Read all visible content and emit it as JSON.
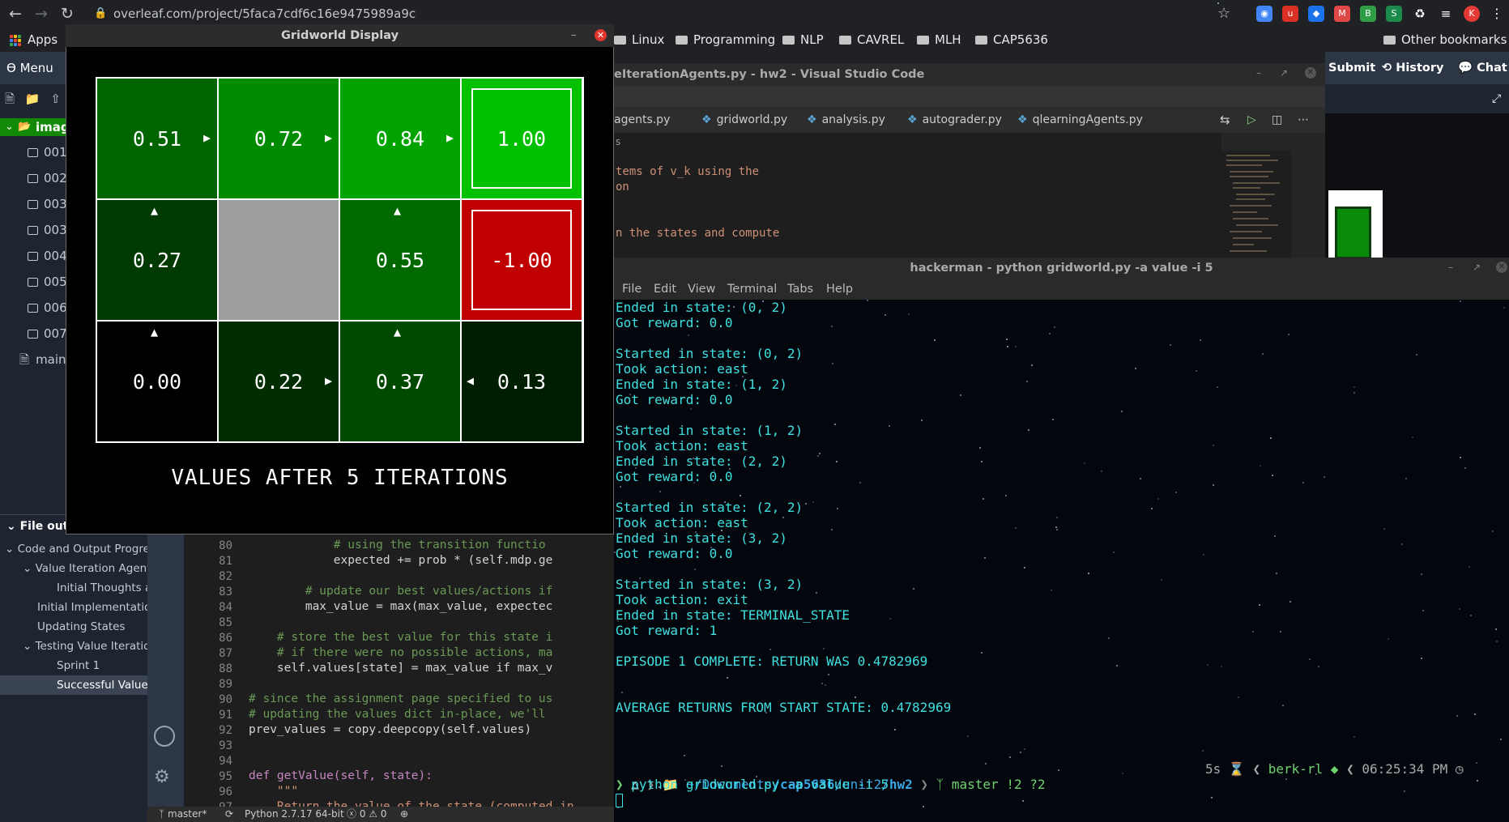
{
  "browser": {
    "url": "overleaf.com/project/5faca7cdf6c16e9475989a9c",
    "bookmarks": [
      "Apps",
      "Linux",
      "Programming",
      "NLP",
      "CAVREL",
      "MLH",
      "CAP5636",
      "Other bookmarks"
    ]
  },
  "overleaf": {
    "menu_label": "Menu",
    "tree_root": "image",
    "files": [
      "001",
      "002",
      "003",
      "003",
      "004",
      "005",
      "006",
      "007",
      "main."
    ],
    "outline_header": "File outli",
    "outline_items": [
      "Code and Output Progres",
      "Value Iteration Agent",
      "Initial Thoughts an",
      "Initial Implementatio",
      "Updating States",
      "Testing Value Iteratio",
      "Sprint 1",
      "Successful Value I"
    ],
    "submit_label": "Submit",
    "history_label": "History",
    "chat_label": "Chat"
  },
  "code_editor": {
    "lines": [
      {
        "n": "80",
        "text": "            # using the transition functio"
      },
      {
        "n": "81",
        "text": "            expected += prob * (self.mdp.ge"
      },
      {
        "n": "82",
        "text": ""
      },
      {
        "n": "83",
        "text": "        # update our best values/actions if"
      },
      {
        "n": "84",
        "text": "        max_value = max(max_value, expectec"
      },
      {
        "n": "85",
        "text": ""
      },
      {
        "n": "86",
        "text": "    # store the best value for this state i"
      },
      {
        "n": "87",
        "text": "    # if there were no possible actions, ma"
      },
      {
        "n": "88",
        "text": "    self.values[state] = max_value if max_v"
      },
      {
        "n": "89",
        "text": ""
      },
      {
        "n": "90",
        "text": "# since the assignment page specified to us"
      },
      {
        "n": "91",
        "text": "# updating the values dict in-place, we'll"
      },
      {
        "n": "92",
        "text": "prev_values = copy.deepcopy(self.values)"
      },
      {
        "n": "93",
        "text": ""
      },
      {
        "n": "94",
        "text": ""
      },
      {
        "n": "95",
        "text": "def getValue(self, state):"
      },
      {
        "n": "96",
        "text": "    \"\"\""
      },
      {
        "n": "97",
        "text": "    Return the value of the state (computed in"
      }
    ],
    "status": {
      "branch": "master*",
      "python": "Python 2.7.17 64-bit",
      "problems": "ⓧ 0 ⚠ 0"
    }
  },
  "vscode": {
    "title": "eIterationAgents.py - hw2 - Visual Studio Code",
    "tabs": [
      "agents.py",
      "gridworld.py",
      "analysis.py",
      "autograder.py",
      "qlearningAgents.py"
    ],
    "breadcrumb": "s",
    "lines": [
      "tems of v_k using the",
      "on",
      "",
      "",
      "n the states and compute"
    ]
  },
  "terminal": {
    "title": "hackerman - python gridworld.py -a value -i 5",
    "menu": [
      "File",
      "Edit",
      "View",
      "Terminal",
      "Tabs",
      "Help"
    ],
    "output": [
      "Ended in state: (0, 2)",
      "Got reward: 0.0",
      "",
      "Started in state: (0, 2)",
      "Took action: east",
      "Ended in state: (1, 2)",
      "Got reward: 0.0",
      "",
      "Started in state: (1, 2)",
      "Took action: east",
      "Ended in state: (2, 2)",
      "Got reward: 0.0",
      "",
      "Started in state: (2, 2)",
      "Took action: east",
      "Ended in state: (3, 2)",
      "Got reward: 0.0",
      "",
      "Started in state: (3, 2)",
      "Took action: exit",
      "Ended in state: TERMINAL_STATE",
      "Got reward: 1",
      "",
      "EPISODE 1 COMPLETE: RETURN WAS 0.4782969",
      "",
      "",
      "AVERAGE RETURNS FROM START STATE: 0.4782969"
    ],
    "prompt": {
      "path_prefix": "~/Documents/",
      "path_bold": "cap5636",
      "path_mid": "/unit2/",
      "path_end": "hw2",
      "git": "master !2 ?2",
      "duration": "5s",
      "env": "berk-rl",
      "time": "06:25:34 PM"
    },
    "command": "python gridworld.py -a value -i 5"
  },
  "gridworld": {
    "window_title": "Gridworld Display",
    "caption": "VALUES AFTER 5 ITERATIONS",
    "cells": [
      {
        "value": "0.51",
        "arrow": "east",
        "color": "#006400"
      },
      {
        "value": "0.72",
        "arrow": "east",
        "color": "#008c00"
      },
      {
        "value": "0.84",
        "arrow": "east",
        "color": "#00a300"
      },
      {
        "value": "1.00",
        "arrow": "",
        "color": "#00c000",
        "terminal": true
      },
      {
        "value": "0.27",
        "arrow": "north",
        "color": "#003a00"
      },
      {
        "value": "",
        "arrow": "",
        "color": "#9e9e9e",
        "wall": true
      },
      {
        "value": "0.55",
        "arrow": "north",
        "color": "#006a00"
      },
      {
        "value": "-1.00",
        "arrow": "",
        "color": "#c00000",
        "terminal": true
      },
      {
        "value": "0.00",
        "arrow": "north",
        "color": "#000000"
      },
      {
        "value": "0.22",
        "arrow": "east",
        "color": "#002e00"
      },
      {
        "value": "0.37",
        "arrow": "north",
        "color": "#004a00"
      },
      {
        "value": "0.13",
        "arrow": "west",
        "color": "#001e00"
      }
    ]
  }
}
